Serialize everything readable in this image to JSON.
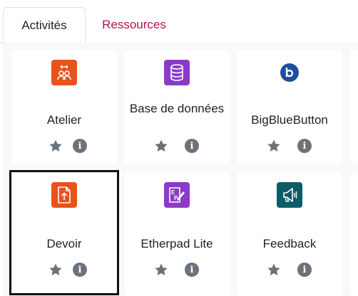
{
  "tabs": [
    {
      "label": "Activités",
      "active": true
    },
    {
      "label": "Ressources",
      "active": false
    }
  ],
  "colors": {
    "link": "#b4124f",
    "collaboration": "#e8531c",
    "database": "#8c3ac7",
    "communication": "#0d5d69",
    "bbb": "#1e4f9c",
    "action_icon": "#6a737b"
  },
  "modules": [
    {
      "name": "Atelier",
      "icon": "workshop-icon",
      "selected": false
    },
    {
      "name": "Base de données",
      "icon": "database-icon",
      "selected": false
    },
    {
      "name": "BigBlueButton",
      "icon": "bigbluebutton-icon",
      "selected": false
    },
    {
      "name": "Devoir",
      "icon": "assignment-icon",
      "selected": true
    },
    {
      "name": "Etherpad Lite",
      "icon": "etherpad-icon",
      "selected": false
    },
    {
      "name": "Feedback",
      "icon": "feedback-icon",
      "selected": false
    }
  ]
}
